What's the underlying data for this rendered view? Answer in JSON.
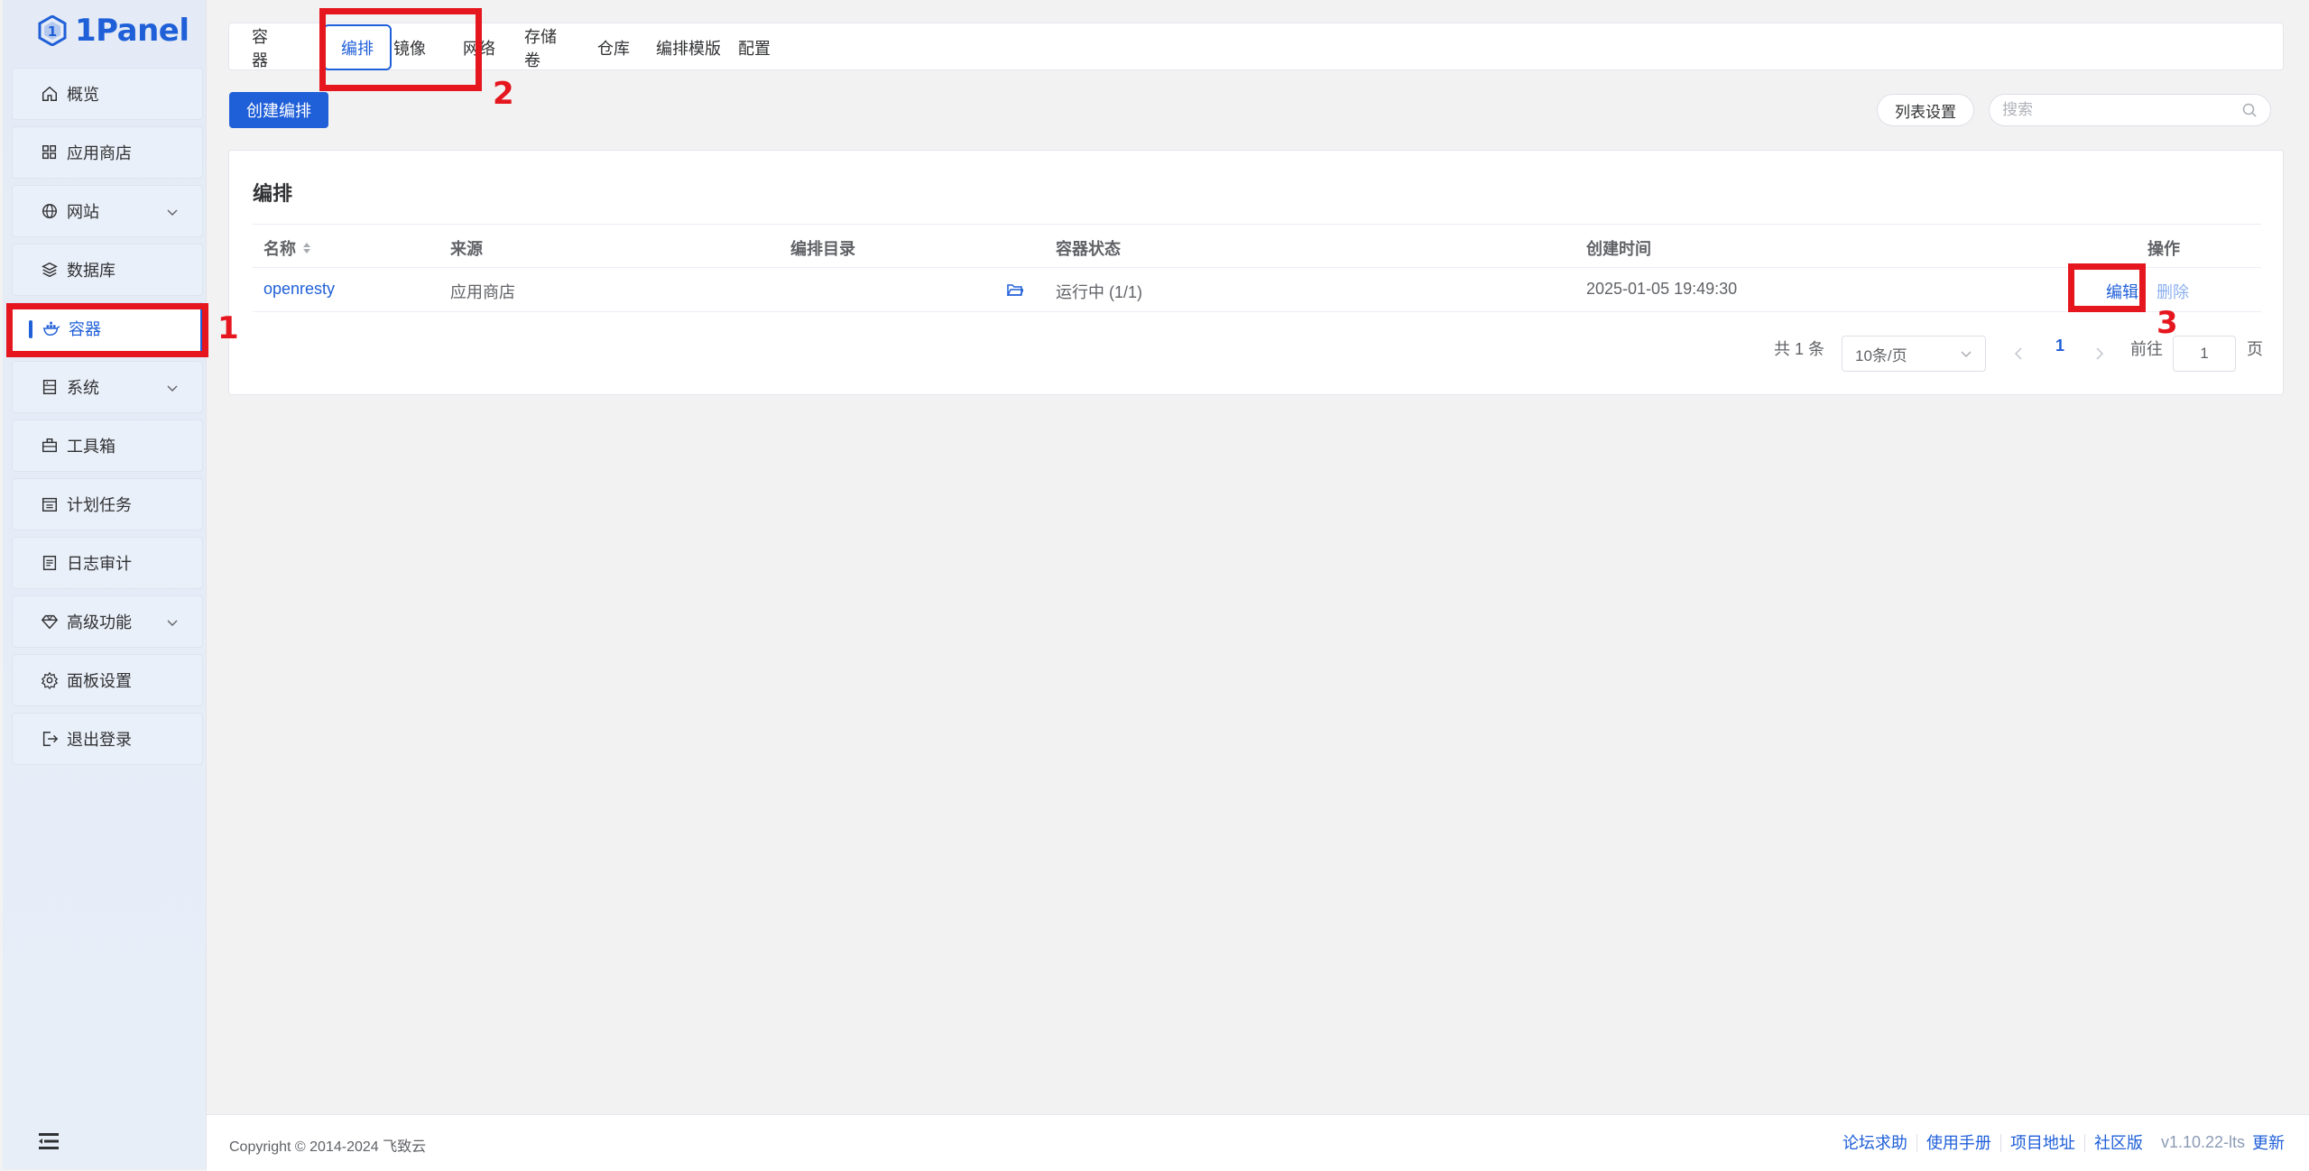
{
  "brand": {
    "name": "1Panel",
    "color": "#1f5fd8"
  },
  "sidebar": {
    "items": [
      {
        "label": "概览",
        "icon": "home-icon",
        "has_children": false,
        "active": false
      },
      {
        "label": "应用商店",
        "icon": "apps-grid-icon",
        "has_children": false,
        "active": false
      },
      {
        "label": "网站",
        "icon": "globe-icon",
        "has_children": true,
        "active": false
      },
      {
        "label": "数据库",
        "icon": "layers-icon",
        "has_children": false,
        "active": false
      },
      {
        "label": "容器",
        "icon": "docker-whale-icon",
        "has_children": false,
        "active": true
      },
      {
        "label": "系统",
        "icon": "server-icon",
        "has_children": true,
        "active": false
      },
      {
        "label": "工具箱",
        "icon": "toolbox-icon",
        "has_children": false,
        "active": false
      },
      {
        "label": "计划任务",
        "icon": "calendar-icon",
        "has_children": false,
        "active": false
      },
      {
        "label": "日志审计",
        "icon": "log-document-icon",
        "has_children": false,
        "active": false
      },
      {
        "label": "高级功能",
        "icon": "diamond-icon",
        "has_children": true,
        "active": false
      },
      {
        "label": "面板设置",
        "icon": "gear-icon",
        "has_children": false,
        "active": false
      },
      {
        "label": "退出登录",
        "icon": "logout-icon",
        "has_children": false,
        "active": false
      }
    ]
  },
  "tabs": [
    {
      "label": "容器",
      "active": false
    },
    {
      "label": "编排",
      "active": true
    },
    {
      "label": "镜像",
      "active": false
    },
    {
      "label": "网络",
      "active": false
    },
    {
      "label": "存储卷",
      "active": false
    },
    {
      "label": "仓库",
      "active": false
    },
    {
      "label": "编排模版",
      "active": false
    },
    {
      "label": "配置",
      "active": false
    }
  ],
  "toolbar": {
    "create_label": "创建编排",
    "list_settings_label": "列表设置",
    "search_placeholder": "搜索",
    "search_value": ""
  },
  "card": {
    "title": "编排",
    "columns": [
      "名称",
      "来源",
      "编排目录",
      "容器状态",
      "创建时间",
      "操作"
    ],
    "rows": [
      {
        "name": "openresty",
        "source": "应用商店",
        "dir_icon": "folder-open-icon",
        "status": "运行中 (1/1)",
        "created": "2025-01-05 19:49:30",
        "actions": [
          "编辑",
          "删除"
        ]
      }
    ]
  },
  "pagination": {
    "total_label": "共 1 条",
    "page_size": "10条/页",
    "current_page": "1",
    "goto_label": "前往",
    "goto_value": "1",
    "page_suffix": "页"
  },
  "annotations": [
    {
      "number": "1",
      "target": "sidebar-item-容器"
    },
    {
      "number": "2",
      "target": "tab-编排"
    },
    {
      "number": "3",
      "target": "edit-action"
    }
  ],
  "footer": {
    "copyright": "Copyright © 2014-2024 飞致云",
    "links": [
      "论坛求助",
      "使用手册",
      "项目地址",
      "社区版"
    ],
    "version": "v1.10.22-lts",
    "update_label": "更新"
  },
  "colors": {
    "accent": "#1f5fd8",
    "annotation": "#e5161e",
    "background": "#f2f2f2"
  }
}
